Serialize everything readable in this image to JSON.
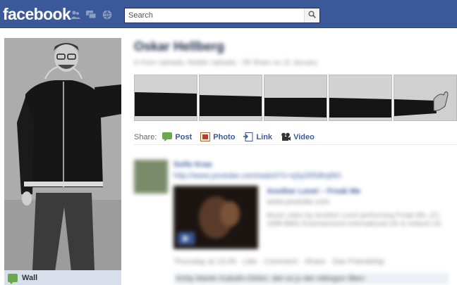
{
  "topbar": {
    "logo": "facebook",
    "icons": [
      "friend-requests-icon",
      "messages-icon",
      "notifications-icon"
    ],
    "search_placeholder": "Search"
  },
  "sidebar": {
    "items": [
      {
        "label": "Wall",
        "icon": "wall-icon"
      }
    ]
  },
  "profile": {
    "name": "Oskar Hellberg",
    "meta": "In from Uploads, Mobile Uploads · 08 Share on 21 January"
  },
  "share": {
    "label": "Share:",
    "actions": [
      {
        "label": "Post",
        "icon": "post-icon"
      },
      {
        "label": "Photo",
        "icon": "photo-icon"
      },
      {
        "label": "Link",
        "icon": "link-icon"
      },
      {
        "label": "Video",
        "icon": "video-icon"
      }
    ]
  },
  "story": {
    "author": "Sofie Kraa",
    "link_url": "http://www.youtube.com/watch?v=q3yZ65dhq5Kl",
    "preview_title": "Another Level – Freak Me",
    "preview_domain": "www.youtube.com",
    "preview_desc": "Music video by Another Level performing Freak Me. (C) 1998 BMG Entertainment International UK & Ireland Ltd",
    "footer": "Thursday at 13:45 · Like · Comment · Share · See Friendship",
    "comment": "Kirby Martin Kalsdin-Dirkin: det va ju det nittiogon låten"
  }
}
